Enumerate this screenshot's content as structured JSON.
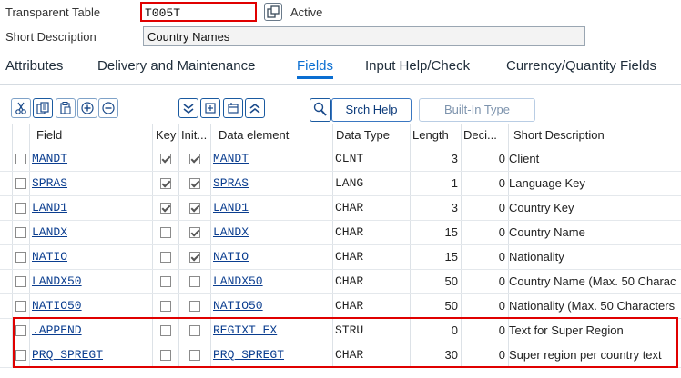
{
  "header": {
    "table_type_label": "Transparent Table",
    "table_name": "T005T",
    "status": "Active",
    "short_desc_label": "Short Description",
    "short_desc_value": "Country Names"
  },
  "tabs": [
    {
      "label": "Attributes",
      "active": false
    },
    {
      "label": "Delivery and Maintenance",
      "active": false
    },
    {
      "label": "Fields",
      "active": true
    },
    {
      "label": "Input Help/Check",
      "active": false
    },
    {
      "label": "Currency/Quantity Fields",
      "active": false
    }
  ],
  "toolbar": {
    "icons": [
      "cut-icon",
      "copy-icon",
      "paste-icon",
      "insert-row-icon",
      "delete-row-icon",
      "expand-all-icon",
      "insert-structure-icon",
      "structure-icon",
      "collapse-all-icon",
      "search-help-icon"
    ],
    "srch_help_label": "Srch Help",
    "builtin_type_label": "Built-In Type"
  },
  "table": {
    "columns": {
      "field": "Field",
      "key": "Key",
      "initial": "Init...",
      "data_element": "Data element",
      "data_type": "Data Type",
      "length": "Length",
      "decimals": "Deci...",
      "short_description": "Short Description"
    },
    "rows": [
      {
        "field": "MANDT",
        "key": true,
        "initial": true,
        "data_element": "MANDT",
        "data_type": "CLNT",
        "length": "3",
        "decimals": "0",
        "short_description": "Client"
      },
      {
        "field": "SPRAS",
        "key": true,
        "initial": true,
        "data_element": "SPRAS",
        "data_type": "LANG",
        "length": "1",
        "decimals": "0",
        "short_description": "Language Key"
      },
      {
        "field": "LAND1",
        "key": true,
        "initial": true,
        "data_element": "LAND1",
        "data_type": "CHAR",
        "length": "3",
        "decimals": "0",
        "short_description": "Country Key"
      },
      {
        "field": "LANDX",
        "key": false,
        "initial": true,
        "data_element": "LANDX",
        "data_type": "CHAR",
        "length": "15",
        "decimals": "0",
        "short_description": "Country Name"
      },
      {
        "field": "NATIO",
        "key": false,
        "initial": true,
        "data_element": "NATIO",
        "data_type": "CHAR",
        "length": "15",
        "decimals": "0",
        "short_description": "Nationality"
      },
      {
        "field": "LANDX50",
        "key": false,
        "initial": false,
        "data_element": "LANDX50",
        "data_type": "CHAR",
        "length": "50",
        "decimals": "0",
        "short_description": "Country Name (Max. 50 Charac"
      },
      {
        "field": "NATIO50",
        "key": false,
        "initial": false,
        "data_element": "NATIO50",
        "data_type": "CHAR",
        "length": "50",
        "decimals": "0",
        "short_description": "Nationality (Max. 50 Characters"
      },
      {
        "field": ".APPEND",
        "key": false,
        "initial": false,
        "data_element": "REGTXT_EX",
        "data_type": "STRU",
        "length": "0",
        "decimals": "0",
        "short_description": "Text for Super Region"
      },
      {
        "field": "PRQ_SPREGT",
        "key": false,
        "initial": false,
        "data_element": "PRQ_SPREGT",
        "data_type": "CHAR",
        "length": "30",
        "decimals": "0",
        "short_description": "Super region per country text"
      }
    ]
  },
  "colors": {
    "accent": "#0a6ed1",
    "highlight": "#e00000",
    "link": "#0a3d8f"
  }
}
